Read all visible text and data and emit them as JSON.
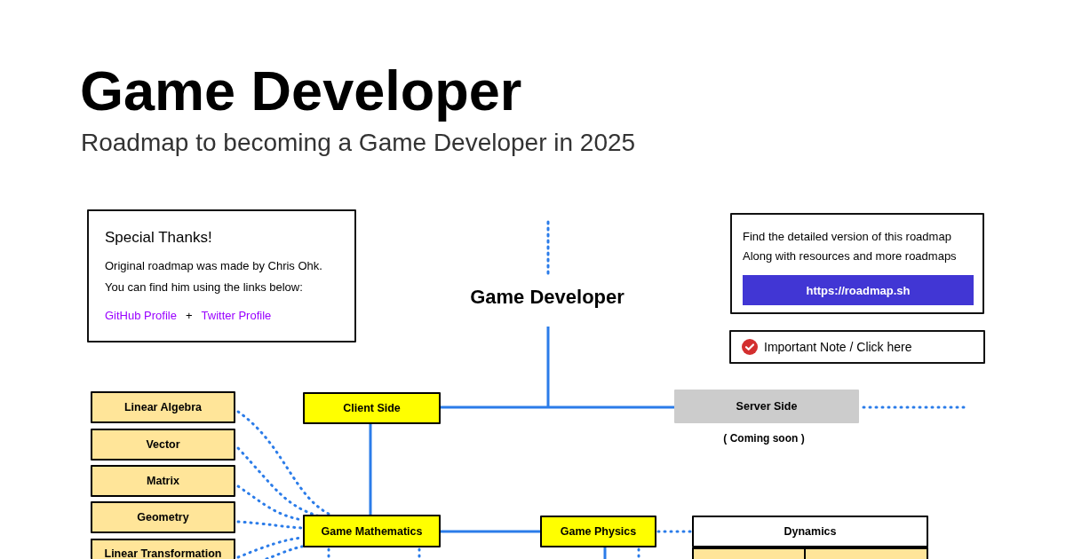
{
  "header": {
    "title": "Game Developer",
    "subtitle": "Roadmap to becoming a Game Developer in 2025"
  },
  "thanks_card": {
    "heading": "Special Thanks!",
    "lines": [
      "Original roadmap was made by Chris Ohk.",
      "You can find him using the links below:"
    ],
    "links": [
      "GitHub Profile",
      "Twitter Profile"
    ],
    "separator": "+"
  },
  "info_card": {
    "lines": [
      "Find the detailed version of this roadmap",
      "Along with resources and more roadmaps"
    ],
    "button": "https://roadmap.sh"
  },
  "note": {
    "label": "Important Note / Click here"
  },
  "roadmap": {
    "title": "Game Developer",
    "caption": "( Coming soon )",
    "nodes": [
      {
        "label": "Linear Algebra",
        "kind": "subtopic"
      },
      {
        "label": "Client Side",
        "kind": "topic"
      },
      {
        "label": "Server Side",
        "kind": "disabled"
      },
      {
        "label": "Vector",
        "kind": "subtopic"
      },
      {
        "label": "Matrix",
        "kind": "subtopic"
      },
      {
        "label": "Geometry",
        "kind": "subtopic"
      },
      {
        "label": "Game Mathematics",
        "kind": "topic"
      },
      {
        "label": "Game Physics",
        "kind": "topic"
      },
      {
        "label": "Dynamics",
        "kind": "plain"
      },
      {
        "label": "Linear Transformation",
        "kind": "subtopic"
      }
    ]
  }
}
